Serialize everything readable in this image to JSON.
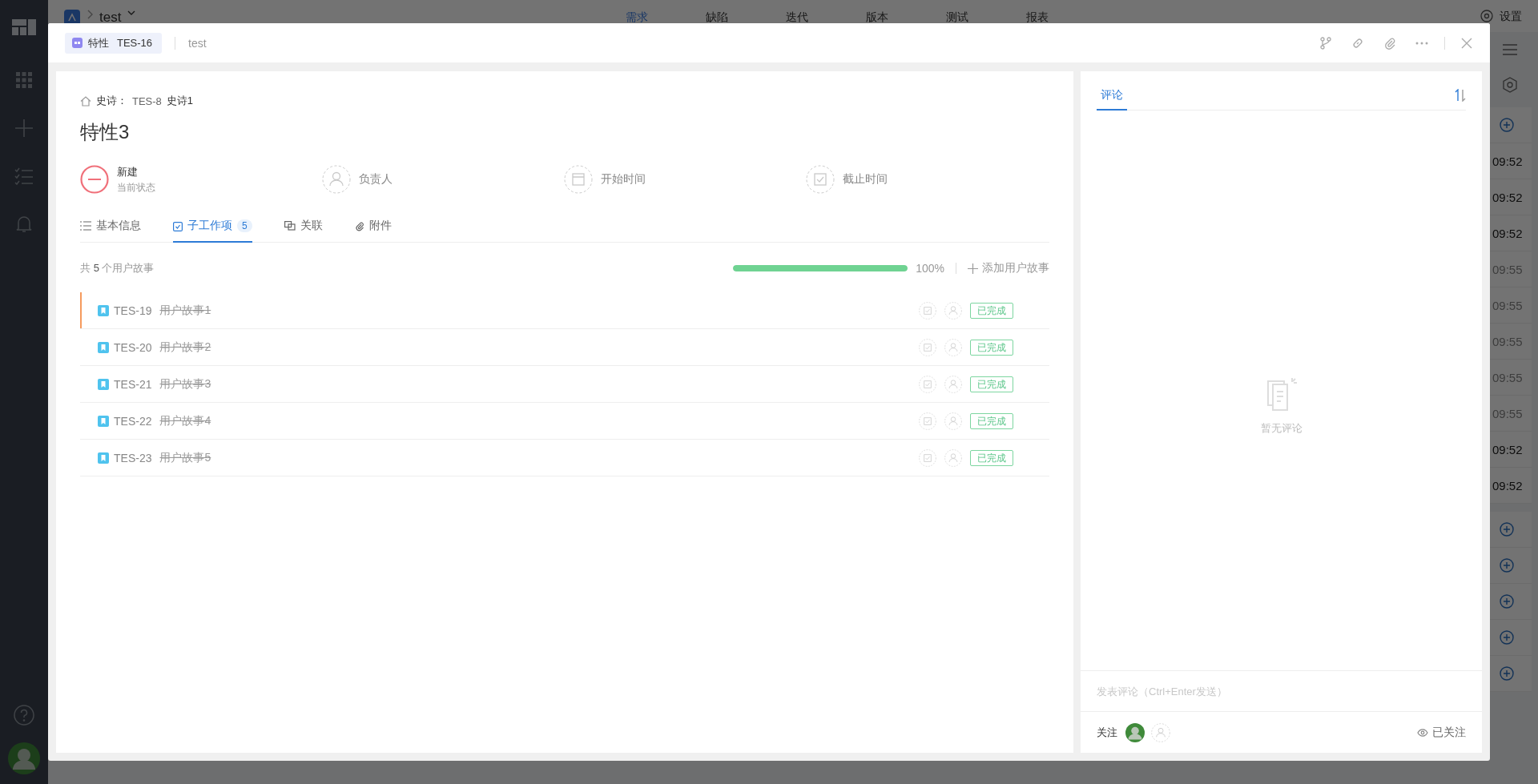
{
  "background": {
    "project": "test",
    "nav_tabs": [
      {
        "label": "需求",
        "selected": true
      },
      {
        "label": "缺陷",
        "selected": false
      },
      {
        "label": "迭代",
        "selected": false
      },
      {
        "label": "版本",
        "selected": false
      },
      {
        "label": "测试",
        "selected": false
      },
      {
        "label": "报表",
        "selected": false
      }
    ],
    "settings": "设置",
    "times": [
      {
        "text": "09:52",
        "dimmed": false
      },
      {
        "text": "09:52",
        "dimmed": false
      },
      {
        "text": "09:52",
        "dimmed": false
      },
      {
        "text": "09:55",
        "dimmed": true
      },
      {
        "text": "09:55",
        "dimmed": true
      },
      {
        "text": "09:55",
        "dimmed": true
      },
      {
        "text": "09:55",
        "dimmed": true
      },
      {
        "text": "09:55",
        "dimmed": true
      },
      {
        "text": "09:52",
        "dimmed": false
      },
      {
        "text": "09:52",
        "dimmed": false
      }
    ]
  },
  "modal": {
    "type": "特性",
    "key": "TES-16",
    "project": "test",
    "breadcrumb": {
      "label": "史诗：",
      "key": "TES-8",
      "title": "史诗1"
    },
    "title": "特性3",
    "fields": [
      {
        "kind": "status",
        "label": "新建",
        "caption": "当前状态"
      },
      {
        "kind": "assignee",
        "label": "负责人"
      },
      {
        "kind": "start",
        "label": "开始时间"
      },
      {
        "kind": "due",
        "label": "截止时间"
      }
    ],
    "tabs": [
      {
        "kind": "info",
        "label": "基本信息",
        "selected": false
      },
      {
        "kind": "subtasks",
        "label": "子工作项",
        "count": "5",
        "selected": true
      },
      {
        "kind": "links",
        "label": "关联",
        "selected": false
      },
      {
        "kind": "attachments",
        "label": "附件",
        "selected": false
      }
    ],
    "summary": "共 **5** 个用户故事",
    "progress": {
      "level": 1.0,
      "reading": "100%"
    },
    "add_button": "添加用户故事",
    "rows": [
      {
        "key": "TES-19",
        "title": "用户故事1",
        "done": true,
        "status": "已完成",
        "selected": true
      },
      {
        "key": "TES-20",
        "title": "用户故事2",
        "done": true,
        "status": "已完成",
        "selected": false
      },
      {
        "key": "TES-21",
        "title": "用户故事3",
        "done": true,
        "status": "已完成",
        "selected": false
      },
      {
        "key": "TES-22",
        "title": "用户故事4",
        "done": true,
        "status": "已完成",
        "selected": false
      },
      {
        "key": "TES-23",
        "title": "用户故事5",
        "done": true,
        "status": "已完成",
        "selected": false
      }
    ],
    "comments": {
      "tab": {
        "label": "评论",
        "selected": true
      },
      "empty": "暂无评论",
      "placeholder": "发表评论（Ctrl+Enter发送）",
      "followers_label": "关注",
      "watch": "已关注"
    }
  }
}
